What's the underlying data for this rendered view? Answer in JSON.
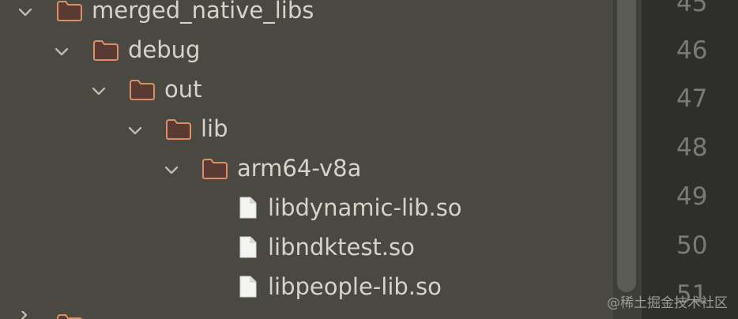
{
  "tree": {
    "items": [
      {
        "label": "merged_native_libs",
        "kind": "folder",
        "expanded": true
      },
      {
        "label": "debug",
        "kind": "folder",
        "expanded": true
      },
      {
        "label": "out",
        "kind": "folder",
        "expanded": true
      },
      {
        "label": "lib",
        "kind": "folder",
        "expanded": true
      },
      {
        "label": "arm64-v8a",
        "kind": "folder",
        "expanded": true
      },
      {
        "label": "libdynamic-lib.so",
        "kind": "file"
      },
      {
        "label": "libndktest.so",
        "kind": "file"
      },
      {
        "label": "libpeople-lib.so",
        "kind": "file"
      }
    ]
  },
  "gutter": {
    "line_numbers": [
      "45",
      "46",
      "47",
      "48",
      "49",
      "50",
      "51"
    ]
  },
  "watermark": {
    "text": "@稀土掘金技术社区"
  },
  "colors": {
    "panel_bg": "#494941",
    "folder_fill": "#5a3b34",
    "folder_stroke": "#d98f68",
    "text": "#d4d4cc",
    "gutter_bg": "#2e2e2b",
    "line_number": "#7b7b76"
  },
  "icons": {
    "chevron": "chevron-down-icon",
    "folder": "folder-icon",
    "file": "file-icon"
  }
}
